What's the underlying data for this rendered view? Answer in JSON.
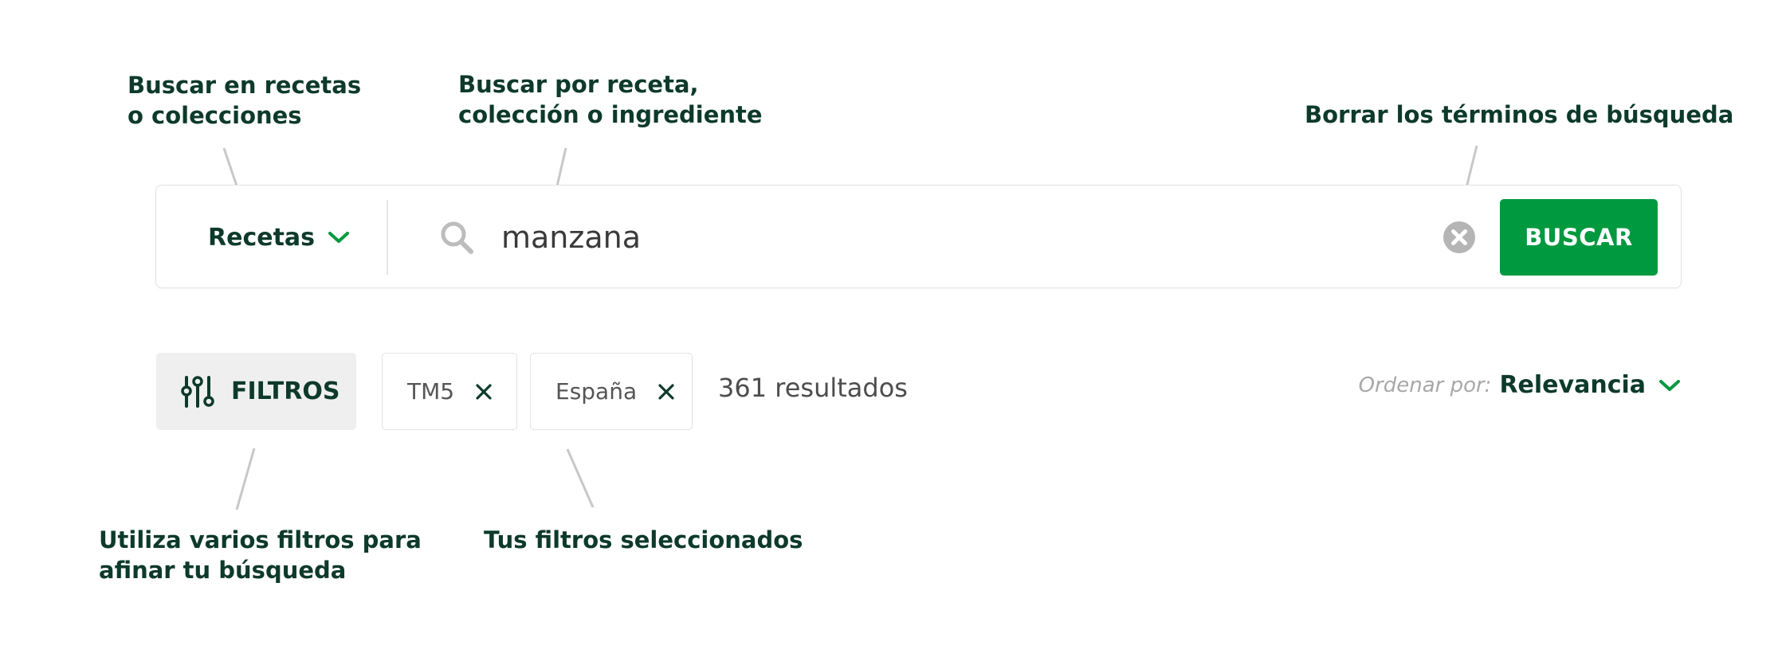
{
  "colors": {
    "accent": "#00993f",
    "text_dark": "#0d3a2a",
    "muted": "#a8a8a8",
    "border": "#e2e2e2",
    "leader_line": "#c8c8c8"
  },
  "annotations": {
    "scope": [
      "Buscar en recetas",
      "o colecciones"
    ],
    "query": [
      "Buscar por receta,",
      "colección o ingrediente"
    ],
    "clear": [
      "Borrar los términos de búsqueda"
    ],
    "filters": [
      "Utiliza varios filtros para",
      "afinar tu búsqueda"
    ],
    "chips": [
      "Tus filtros seleccionados"
    ]
  },
  "searchbar": {
    "scope_label": "Recetas",
    "scope_icon": "chevron-down-icon",
    "search_icon": "search-icon",
    "query_value": "manzana",
    "clear_icon": "clear-circle-icon",
    "submit_label": "BUSCAR"
  },
  "filters": {
    "button_label": "FILTROS",
    "button_icon": "sliders-icon",
    "chips": [
      {
        "label": "TM5",
        "remove_icon": "close-icon"
      },
      {
        "label": "España",
        "remove_icon": "close-icon"
      }
    ],
    "results_text": "361 resultados"
  },
  "sort": {
    "label": "Ordenar por:",
    "value": "Relevancia",
    "icon": "chevron-down-icon"
  }
}
